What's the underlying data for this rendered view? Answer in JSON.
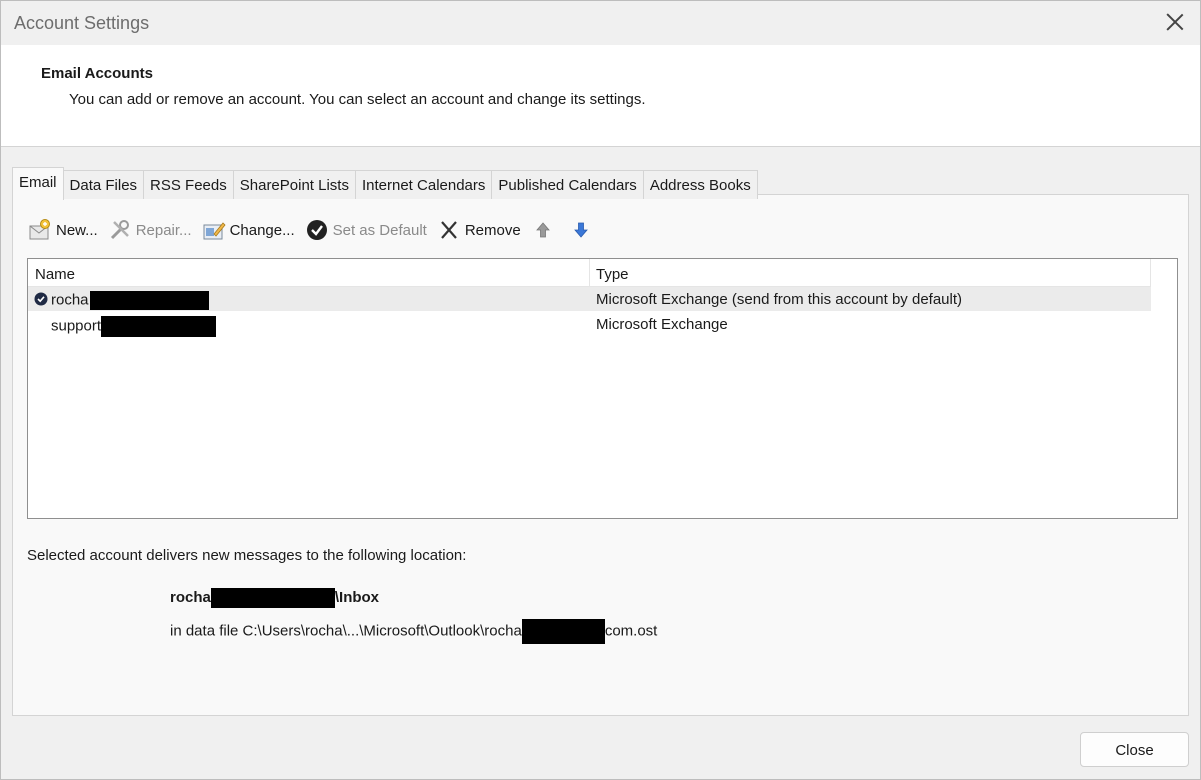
{
  "window": {
    "title": "Account Settings",
    "close_icon": "close-icon"
  },
  "header": {
    "title": "Email Accounts",
    "description": "You can add or remove an account. You can select an account and change its settings."
  },
  "tabs": [
    {
      "label": "Email",
      "active": true
    },
    {
      "label": "Data Files",
      "active": false
    },
    {
      "label": "RSS Feeds",
      "active": false
    },
    {
      "label": "SharePoint Lists",
      "active": false
    },
    {
      "label": "Internet Calendars",
      "active": false
    },
    {
      "label": "Published Calendars",
      "active": false
    },
    {
      "label": "Address Books",
      "active": false
    }
  ],
  "toolbar": {
    "new_label": "New...",
    "repair_label": "Repair...",
    "change_label": "Change...",
    "set_default_label": "Set as Default",
    "remove_label": "Remove"
  },
  "accounts": {
    "columns": {
      "name": "Name",
      "type": "Type"
    },
    "rows": [
      {
        "name": "rocha",
        "type": "Microsoft Exchange (send from this account by default)",
        "default": true,
        "selected": true
      },
      {
        "name": "support",
        "type": "Microsoft Exchange",
        "default": false,
        "selected": false
      }
    ]
  },
  "delivery": {
    "label": "Selected account delivers new messages to the following location:",
    "folder_prefix": "rocha",
    "folder_suffix": "\\Inbox",
    "file_prefix": "in data file C:\\Users\\rocha\\...\\Microsoft\\Outlook\\rocha",
    "file_suffix": "com.ost"
  },
  "footer": {
    "close_label": "Close"
  },
  "colors": {
    "accent_blue": "#2f6fdb",
    "redaction": "#000000"
  }
}
